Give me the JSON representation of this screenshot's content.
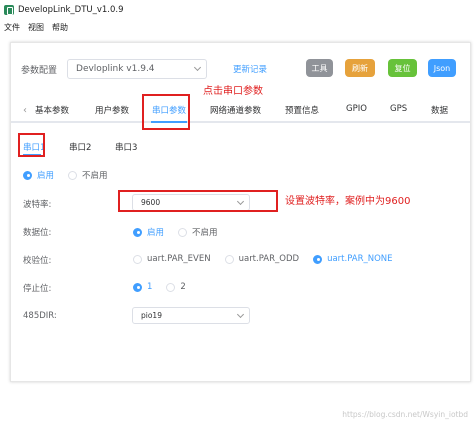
{
  "window": {
    "title": "DevelopLink_DTU_v1.0.9"
  },
  "menu": [
    "文件",
    "视图",
    "帮助"
  ],
  "topbar": {
    "label": "参数配置",
    "version": "Devloplink v1.9.4",
    "update_link": "更新记录",
    "buttons": {
      "tool": "工具",
      "refresh": "刷新",
      "reset": "复位",
      "json": "Json"
    }
  },
  "tabs": [
    "基本参数",
    "用户参数",
    "串口参数",
    "网络通道参数",
    "预置信息",
    "GPIO",
    "GPS",
    "数据"
  ],
  "active_tab": "串口参数",
  "subtabs": [
    "串口1",
    "串口2",
    "串口3"
  ],
  "enable": {
    "on": "启用",
    "off": "不启用",
    "selected": "启用"
  },
  "baud": {
    "label": "波特率:",
    "value": "9600"
  },
  "databits": {
    "label": "数据位:",
    "on": "启用",
    "off": "不启用",
    "selected": "启用"
  },
  "parity": {
    "label": "校验位:",
    "options": [
      "uart.PAR_EVEN",
      "uart.PAR_ODD",
      "uart.PAR_NONE"
    ],
    "selected": "uart.PAR_NONE"
  },
  "stopbits": {
    "label": "停止位:",
    "options": [
      "1",
      "2"
    ],
    "selected": "1"
  },
  "dir485": {
    "label": "485DIR:",
    "value": "pio19"
  },
  "annotations": {
    "click_tab": "点击串口参数",
    "baud_note": "设置波特率，案例中为9600"
  },
  "watermark": "https://blog.csdn.net/Wsyin_iotbd",
  "colors": {
    "accent": "#409eff",
    "annotation": "#e02020",
    "tool": "#909399",
    "refresh": "#e6a23c",
    "reset": "#67c23a",
    "json": "#409eff"
  }
}
